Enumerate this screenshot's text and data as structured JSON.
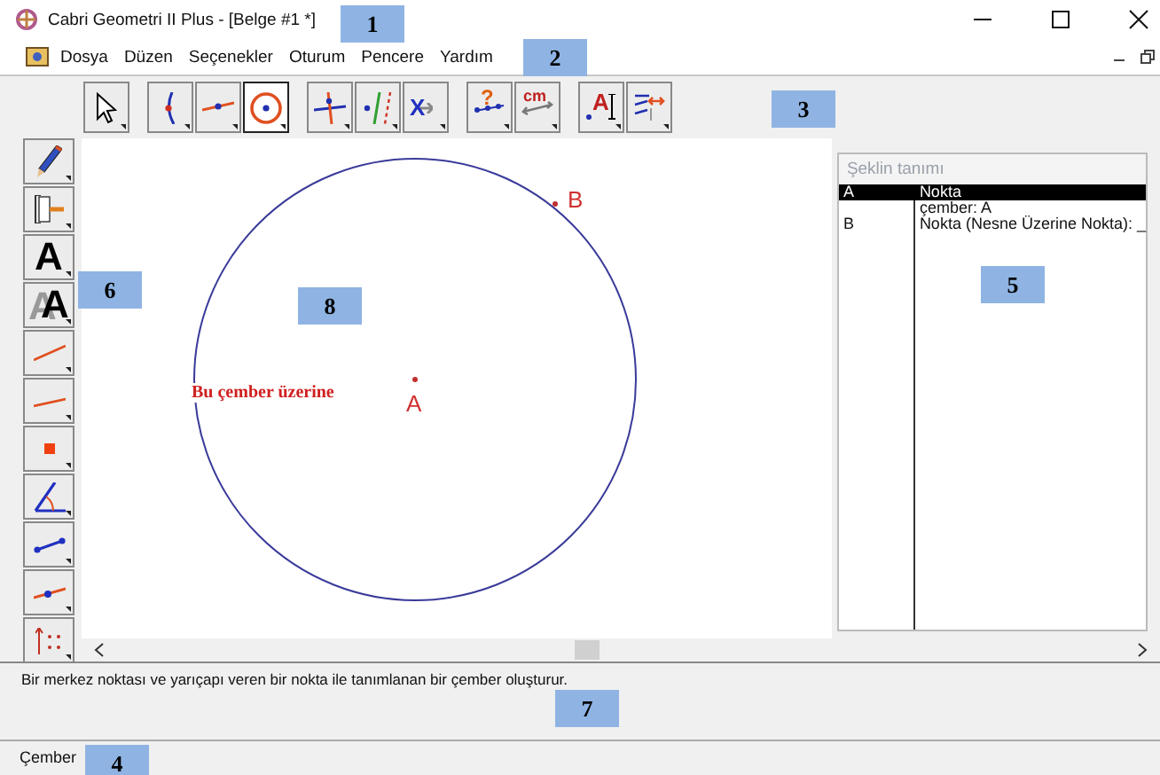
{
  "window": {
    "title": "Cabri Geometri II Plus - [Belge #1 *]"
  },
  "menu": [
    "Dosya",
    "Düzen",
    "Seçenekler",
    "Oturum",
    "Pencere",
    "Yardım"
  ],
  "toolbar": {
    "groups": [
      {
        "tools": [
          {
            "selected": false
          }
        ]
      },
      {
        "tools": [
          {
            "selected": false
          },
          {
            "selected": false
          },
          {
            "selected": true
          }
        ]
      },
      {
        "tools": [
          {
            "selected": false
          },
          {
            "selected": false
          },
          {
            "selected": false,
            "glyph": "X"
          }
        ]
      },
      {
        "tools": [
          {
            "selected": false,
            "glyph": "?"
          },
          {
            "selected": false,
            "glyph": "cm"
          }
        ]
      },
      {
        "tools": [
          {
            "selected": false,
            "glyph": "A"
          },
          {
            "selected": false
          }
        ]
      }
    ]
  },
  "left_toolbar": {
    "tools": [
      {
        "selected": false
      },
      {
        "selected": false
      },
      {
        "selected": false,
        "glyph": "A"
      },
      {
        "selected": false,
        "glyph": "A"
      },
      {
        "selected": false
      },
      {
        "selected": false
      },
      {
        "selected": false
      },
      {
        "selected": false
      },
      {
        "selected": false
      },
      {
        "selected": false
      },
      {
        "selected": false
      }
    ]
  },
  "canvas": {
    "points": [
      {
        "label": "A"
      },
      {
        "label": "B"
      }
    ],
    "text": "Bu çember üzerine"
  },
  "panel": {
    "title": "Şeklin tanımı",
    "rows": [
      {
        "name": "A",
        "description": "Nokta",
        "selected": true
      },
      {
        "description": "çember: A",
        "selected": false
      },
      {
        "name": "B",
        "description": "Nokta (Nesne Üzerine Nokta): _",
        "selected": false
      }
    ]
  },
  "help_text": "Bir merkez noktası ve yarıçapı veren bir nokta ile tanımlanan bir çember oluşturur.",
  "status_bar": "Çember",
  "callouts": [
    "1",
    "2",
    "3",
    "4",
    "5",
    "6",
    "7",
    "8"
  ]
}
